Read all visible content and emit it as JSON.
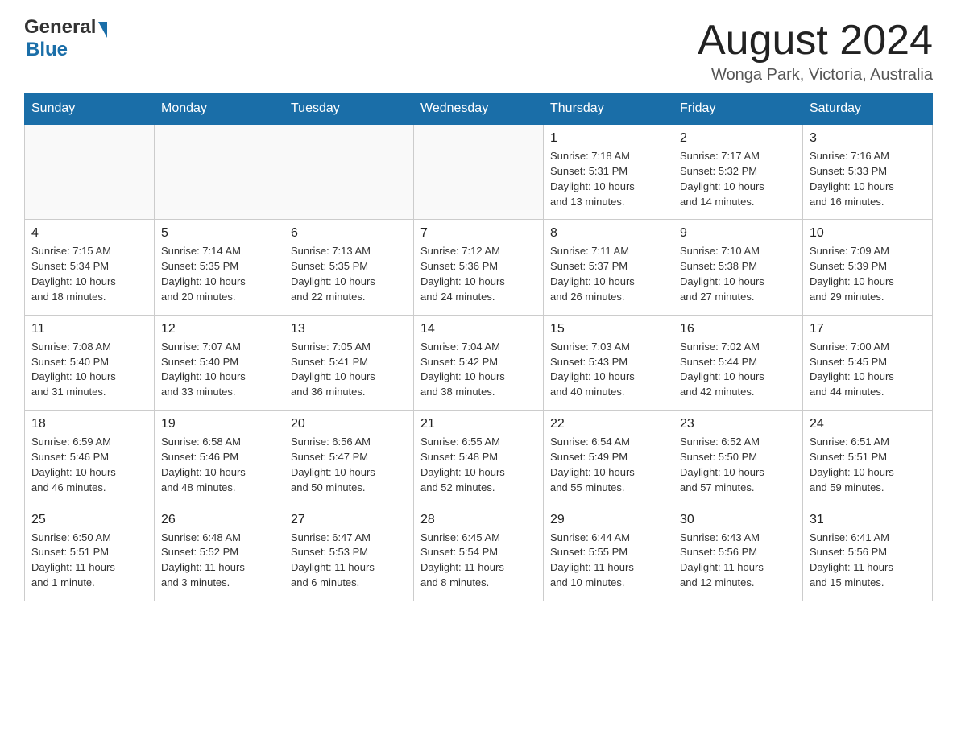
{
  "header": {
    "logo_general": "General",
    "logo_blue": "Blue",
    "month_year": "August 2024",
    "location": "Wonga Park, Victoria, Australia"
  },
  "days_of_week": [
    "Sunday",
    "Monday",
    "Tuesday",
    "Wednesday",
    "Thursday",
    "Friday",
    "Saturday"
  ],
  "weeks": [
    [
      {
        "day": "",
        "info": ""
      },
      {
        "day": "",
        "info": ""
      },
      {
        "day": "",
        "info": ""
      },
      {
        "day": "",
        "info": ""
      },
      {
        "day": "1",
        "info": "Sunrise: 7:18 AM\nSunset: 5:31 PM\nDaylight: 10 hours\nand 13 minutes."
      },
      {
        "day": "2",
        "info": "Sunrise: 7:17 AM\nSunset: 5:32 PM\nDaylight: 10 hours\nand 14 minutes."
      },
      {
        "day": "3",
        "info": "Sunrise: 7:16 AM\nSunset: 5:33 PM\nDaylight: 10 hours\nand 16 minutes."
      }
    ],
    [
      {
        "day": "4",
        "info": "Sunrise: 7:15 AM\nSunset: 5:34 PM\nDaylight: 10 hours\nand 18 minutes."
      },
      {
        "day": "5",
        "info": "Sunrise: 7:14 AM\nSunset: 5:35 PM\nDaylight: 10 hours\nand 20 minutes."
      },
      {
        "day": "6",
        "info": "Sunrise: 7:13 AM\nSunset: 5:35 PM\nDaylight: 10 hours\nand 22 minutes."
      },
      {
        "day": "7",
        "info": "Sunrise: 7:12 AM\nSunset: 5:36 PM\nDaylight: 10 hours\nand 24 minutes."
      },
      {
        "day": "8",
        "info": "Sunrise: 7:11 AM\nSunset: 5:37 PM\nDaylight: 10 hours\nand 26 minutes."
      },
      {
        "day": "9",
        "info": "Sunrise: 7:10 AM\nSunset: 5:38 PM\nDaylight: 10 hours\nand 27 minutes."
      },
      {
        "day": "10",
        "info": "Sunrise: 7:09 AM\nSunset: 5:39 PM\nDaylight: 10 hours\nand 29 minutes."
      }
    ],
    [
      {
        "day": "11",
        "info": "Sunrise: 7:08 AM\nSunset: 5:40 PM\nDaylight: 10 hours\nand 31 minutes."
      },
      {
        "day": "12",
        "info": "Sunrise: 7:07 AM\nSunset: 5:40 PM\nDaylight: 10 hours\nand 33 minutes."
      },
      {
        "day": "13",
        "info": "Sunrise: 7:05 AM\nSunset: 5:41 PM\nDaylight: 10 hours\nand 36 minutes."
      },
      {
        "day": "14",
        "info": "Sunrise: 7:04 AM\nSunset: 5:42 PM\nDaylight: 10 hours\nand 38 minutes."
      },
      {
        "day": "15",
        "info": "Sunrise: 7:03 AM\nSunset: 5:43 PM\nDaylight: 10 hours\nand 40 minutes."
      },
      {
        "day": "16",
        "info": "Sunrise: 7:02 AM\nSunset: 5:44 PM\nDaylight: 10 hours\nand 42 minutes."
      },
      {
        "day": "17",
        "info": "Sunrise: 7:00 AM\nSunset: 5:45 PM\nDaylight: 10 hours\nand 44 minutes."
      }
    ],
    [
      {
        "day": "18",
        "info": "Sunrise: 6:59 AM\nSunset: 5:46 PM\nDaylight: 10 hours\nand 46 minutes."
      },
      {
        "day": "19",
        "info": "Sunrise: 6:58 AM\nSunset: 5:46 PM\nDaylight: 10 hours\nand 48 minutes."
      },
      {
        "day": "20",
        "info": "Sunrise: 6:56 AM\nSunset: 5:47 PM\nDaylight: 10 hours\nand 50 minutes."
      },
      {
        "day": "21",
        "info": "Sunrise: 6:55 AM\nSunset: 5:48 PM\nDaylight: 10 hours\nand 52 minutes."
      },
      {
        "day": "22",
        "info": "Sunrise: 6:54 AM\nSunset: 5:49 PM\nDaylight: 10 hours\nand 55 minutes."
      },
      {
        "day": "23",
        "info": "Sunrise: 6:52 AM\nSunset: 5:50 PM\nDaylight: 10 hours\nand 57 minutes."
      },
      {
        "day": "24",
        "info": "Sunrise: 6:51 AM\nSunset: 5:51 PM\nDaylight: 10 hours\nand 59 minutes."
      }
    ],
    [
      {
        "day": "25",
        "info": "Sunrise: 6:50 AM\nSunset: 5:51 PM\nDaylight: 11 hours\nand 1 minute."
      },
      {
        "day": "26",
        "info": "Sunrise: 6:48 AM\nSunset: 5:52 PM\nDaylight: 11 hours\nand 3 minutes."
      },
      {
        "day": "27",
        "info": "Sunrise: 6:47 AM\nSunset: 5:53 PM\nDaylight: 11 hours\nand 6 minutes."
      },
      {
        "day": "28",
        "info": "Sunrise: 6:45 AM\nSunset: 5:54 PM\nDaylight: 11 hours\nand 8 minutes."
      },
      {
        "day": "29",
        "info": "Sunrise: 6:44 AM\nSunset: 5:55 PM\nDaylight: 11 hours\nand 10 minutes."
      },
      {
        "day": "30",
        "info": "Sunrise: 6:43 AM\nSunset: 5:56 PM\nDaylight: 11 hours\nand 12 minutes."
      },
      {
        "day": "31",
        "info": "Sunrise: 6:41 AM\nSunset: 5:56 PM\nDaylight: 11 hours\nand 15 minutes."
      }
    ]
  ]
}
